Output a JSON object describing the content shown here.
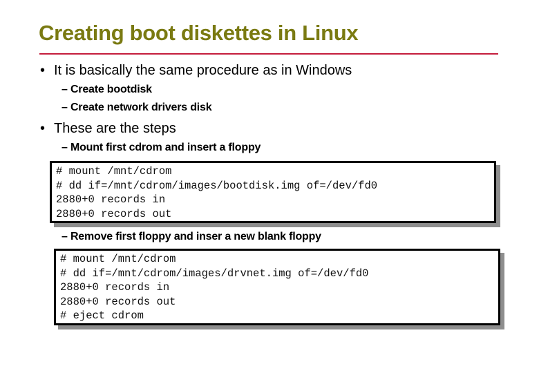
{
  "slide": {
    "title": "Creating boot diskettes in Linux",
    "accent_color": "#c41c3c",
    "title_color": "#7a7a12",
    "bullets": [
      {
        "text": "It is basically the same procedure as in Windows",
        "subitems": [
          "– Create bootdisk",
          "– Create network drivers disk"
        ]
      },
      {
        "text": "These are the steps",
        "subitems": [
          "– Mount first cdrom and insert a floppy",
          "– Remove first floppy and inser a new blank floppy"
        ]
      }
    ],
    "bullet_glyph": "•",
    "code_blocks": [
      {
        "lines": [
          "# mount /mnt/cdrom",
          "# dd if=/mnt/cdrom/images/bootdisk.img of=/dev/fd0",
          "2880+0 records in",
          "2880+0 records out"
        ]
      },
      {
        "lines": [
          "# mount /mnt/cdrom",
          "# dd if=/mnt/cdrom/images/drvnet.img of=/dev/fd0",
          "2880+0 records in",
          "2880+0 records out",
          "# eject cdrom"
        ]
      }
    ]
  }
}
